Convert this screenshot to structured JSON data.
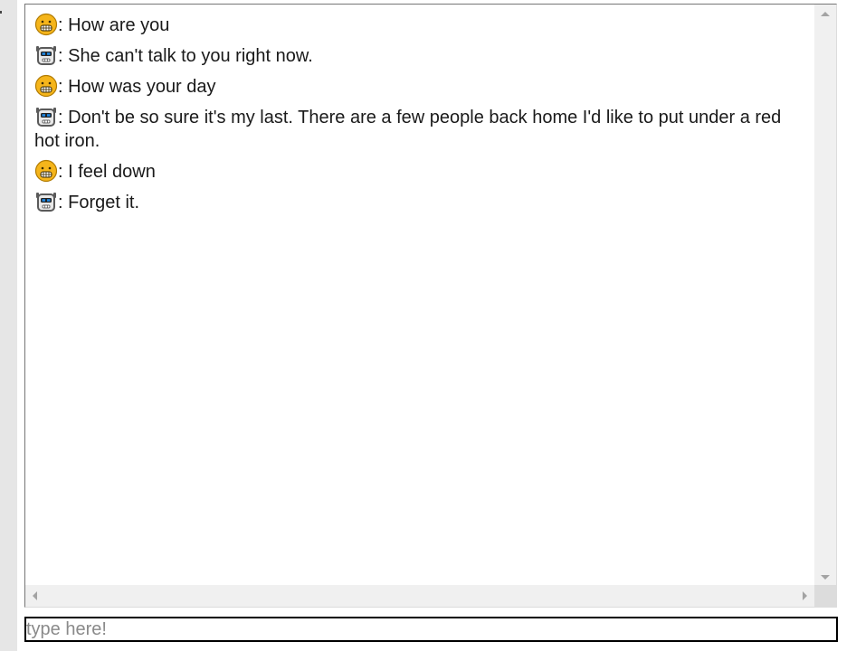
{
  "chat": {
    "messages": [
      {
        "speaker": "user",
        "avatar_icon": "grinning-face-icon",
        "separator": ": ",
        "text": "How are you"
      },
      {
        "speaker": "bot",
        "avatar_icon": "robot-face-icon",
        "separator": ": ",
        "text": "She can't talk to you right now."
      },
      {
        "speaker": "user",
        "avatar_icon": "grinning-face-icon",
        "separator": ": ",
        "text": "How was your day"
      },
      {
        "speaker": "bot",
        "avatar_icon": "robot-face-icon",
        "separator": ": ",
        "text": "Don't be so sure it's my last. There are a few people back home I'd like to put under a red hot iron."
      },
      {
        "speaker": "user",
        "avatar_icon": "grinning-face-icon",
        "separator": ": ",
        "text": "I feel down"
      },
      {
        "speaker": "bot",
        "avatar_icon": "robot-face-icon",
        "separator": ": ",
        "text": "Forget it."
      }
    ]
  },
  "input": {
    "placeholder": "type here!",
    "value": ""
  },
  "colors": {
    "user_avatar": "#f5b51b",
    "bot_avatar_frame": "#5a5a5a",
    "bot_avatar_eyes": "#1e88e5",
    "scrollbar_track": "#f0f0f0",
    "input_border": "#000000"
  }
}
